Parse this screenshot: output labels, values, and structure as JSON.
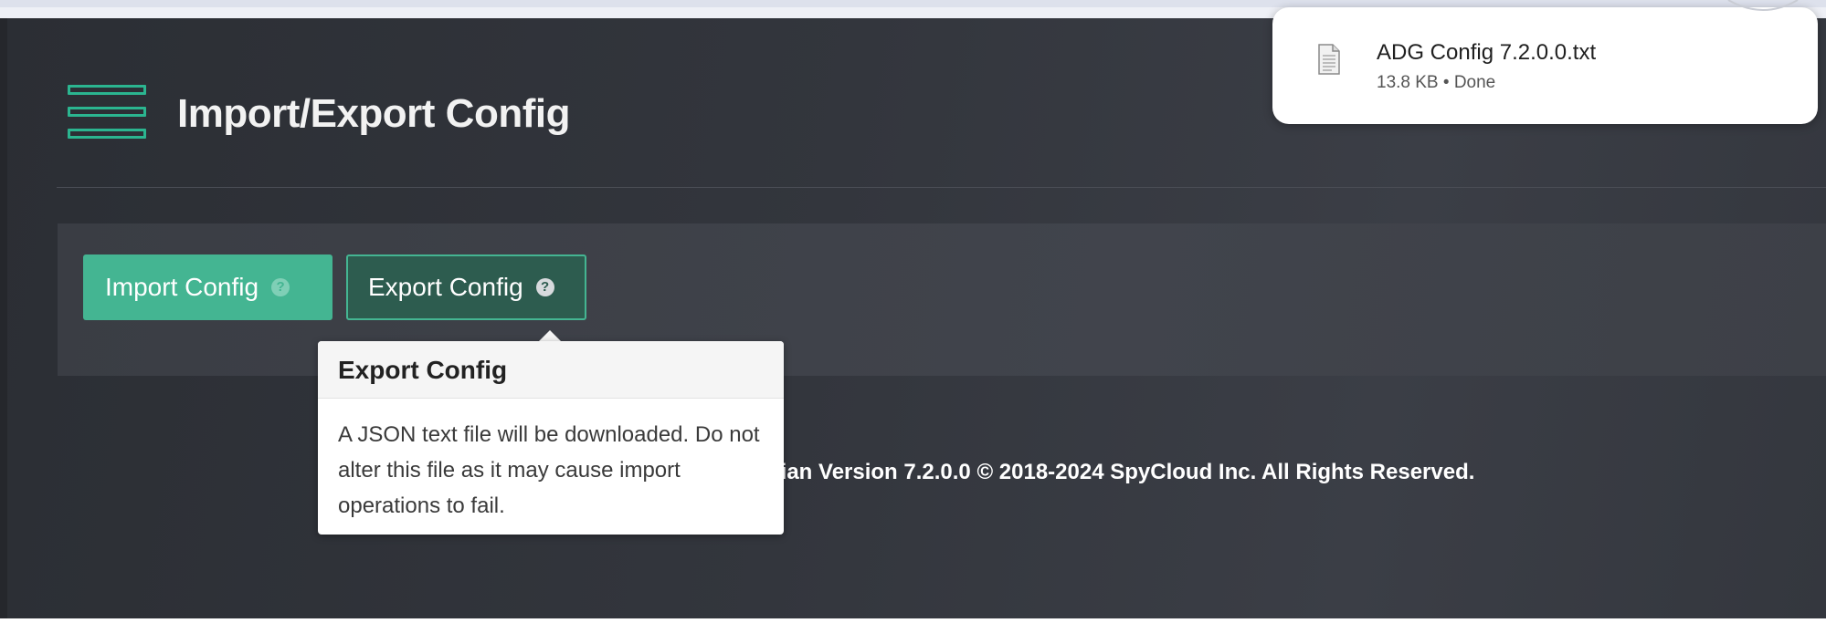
{
  "header": {
    "title": "Import/Export Config",
    "menu_icon": "hamburger-menu-icon"
  },
  "actions": {
    "import_label": "Import Config",
    "export_label": "Export Config",
    "help_glyph": "?"
  },
  "tooltip": {
    "title": "Export Config",
    "body": "A JSON text file will be downloaded. Do not alter this file as it may cause import operations to fail."
  },
  "footer": {
    "copyright_visible": "dian Version 7.2.0.0 © 2018-2024 SpyCloud Inc. All Rights Reserved."
  },
  "download": {
    "file_name": "ADG Config 7.2.0.0.txt",
    "status": "13.8 KB • Done",
    "icon": "file-document-icon"
  },
  "colors": {
    "accent": "#44b592",
    "accent_dark": "#2d5c4f",
    "background": "#33363d",
    "panel": "#3f424a"
  }
}
